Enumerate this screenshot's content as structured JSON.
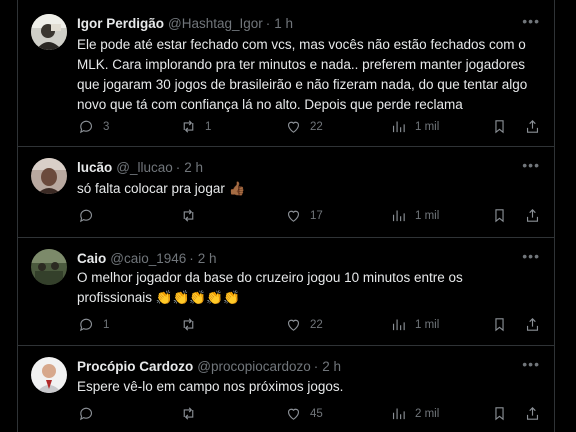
{
  "tweets": [
    {
      "name": "Igor Perdigão",
      "handle": "@Hashtag_Igor",
      "separator": "·",
      "time": "1 h",
      "text": "Ele pode até estar fechado com vcs, mas vocês não estão fechados com o MLK. Cara implorando pra ter minutos e nada.. preferem manter jogadores que jogaram 30 jogos de brasileirão e não fizeram nada, do que tentar algo novo que tá com confiança lá no alto. Depois que perde reclama",
      "replies": "3",
      "reposts": "1",
      "likes": "22",
      "views": "1 mil"
    },
    {
      "name": "lucão",
      "handle": "@_llucao",
      "separator": "·",
      "time": "2 h",
      "text": "só falta colocar pra jogar 👍🏾",
      "replies": "",
      "reposts": "",
      "likes": "17",
      "views": "1 mil"
    },
    {
      "name": "Caio",
      "handle": "@caio_1946",
      "separator": "·",
      "time": "2 h",
      "text": "O melhor jogador da base do cruzeiro jogou 10 minutos entre os profissionais 👏👏👏👏👏",
      "replies": "1",
      "reposts": "",
      "likes": "22",
      "views": "1 mil"
    },
    {
      "name": "Procópio Cardozo",
      "handle": "@procopiocardozo",
      "separator": "·",
      "time": "2 h",
      "text": "Espere vê-lo em campo nos próximos jogos.",
      "replies": "",
      "reposts": "",
      "likes": "45",
      "views": "2 mil"
    }
  ],
  "icons": {
    "reply": "reply-icon",
    "repost": "repost-icon",
    "like": "heart-icon",
    "views": "views-icon",
    "bookmark": "bookmark-icon",
    "share": "share-icon",
    "more": "more-icon"
  },
  "colors": {
    "background": "#000000",
    "text": "#e7e9ea",
    "muted": "#71767b",
    "border": "#2f3336"
  }
}
